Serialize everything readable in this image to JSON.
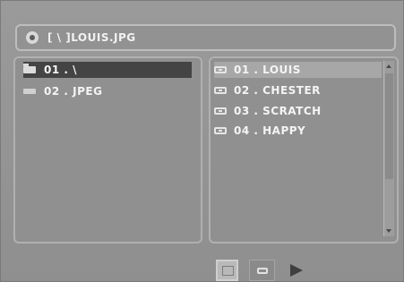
{
  "path_bar": {
    "icon": "disc-icon",
    "text": "[ \\ ]LOUIS.JPG"
  },
  "folders": {
    "items": [
      {
        "label": "01 . \\",
        "icon": "folder-icon",
        "selected": true
      },
      {
        "label": "02 . JPEG",
        "icon": "file-icon",
        "selected": false
      }
    ]
  },
  "files": {
    "items": [
      {
        "label": "01 . LOUIS",
        "icon": "music-icon",
        "highlighted": true
      },
      {
        "label": "02 . CHESTER",
        "icon": "music-icon",
        "highlighted": false
      },
      {
        "label": "03 . SCRATCH",
        "icon": "music-icon",
        "highlighted": false
      },
      {
        "label": "04 . HAPPY",
        "icon": "music-icon",
        "highlighted": false
      }
    ]
  },
  "controls": {
    "photo_mode": "photo-icon",
    "music_mode": "music-icon",
    "play": "play-icon"
  },
  "colors": {
    "background": "#929292",
    "text": "#f4f4f4",
    "selection": "#444444",
    "highlight": "#a7a7a7"
  }
}
